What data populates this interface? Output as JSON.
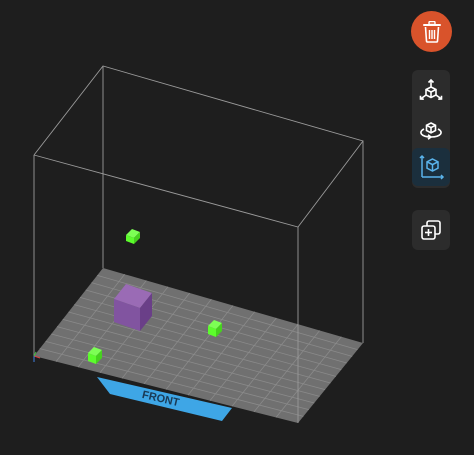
{
  "scene": {
    "bed_label": "FRONT",
    "colors": {
      "background": "#1e1e1e",
      "bed": "#707070",
      "bed_grid": "#8a8a8a",
      "front_tab": "#3ea6e6",
      "build_volume_lines": "#9a9a9a",
      "model_purple": "#8b5aa6",
      "marker_green": "#5cfc2c"
    },
    "objects": [
      {
        "name": "purple-cube"
      },
      {
        "name": "green-marker-floating"
      },
      {
        "name": "green-marker-right"
      },
      {
        "name": "green-marker-front"
      }
    ]
  },
  "toolbar": {
    "delete": {
      "icon": "trash-icon",
      "color": "#d9532b"
    },
    "transform_tools": [
      {
        "name": "move",
        "icon": "move-axes-icon",
        "active": false
      },
      {
        "name": "rotate",
        "icon": "rotate-icon",
        "active": false
      },
      {
        "name": "scale",
        "icon": "scale-cube-icon",
        "active": true
      }
    ],
    "duplicate": {
      "icon": "duplicate-icon"
    }
  }
}
